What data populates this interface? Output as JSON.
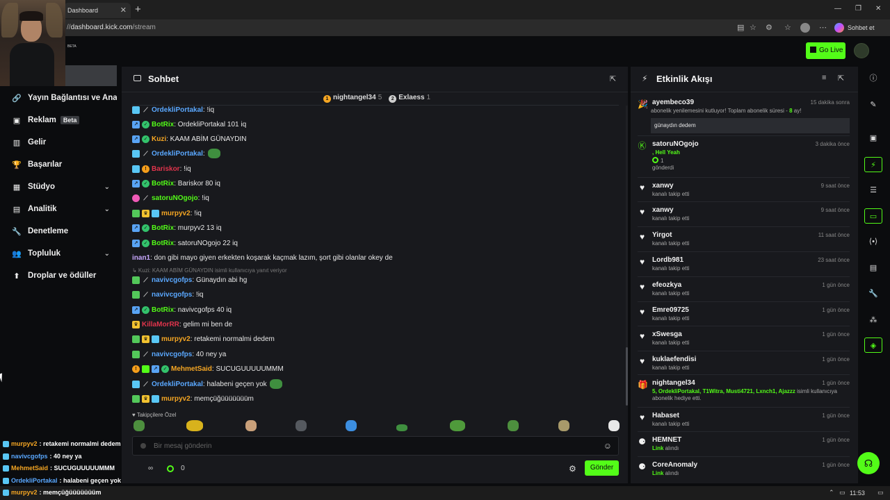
{
  "browser": {
    "tab_title": "Dashboard",
    "tab_close": "✕",
    "new_tab": "+",
    "url_domain": "dashboard.kick.com",
    "url_path": "/stream",
    "url_prefix": "//",
    "sohbet_et": "Sohbet et",
    "win_min": "—",
    "win_max": "❐",
    "win_close": "✕"
  },
  "header": {
    "logo_beta": "BETA",
    "go_live": "Go Live"
  },
  "sidebar": {
    "items": [
      {
        "label": "Yayın Bağlantısı ve Anahtarı",
        "icon": "🔗"
      },
      {
        "label": "Reklam",
        "icon": "▣",
        "badge": "Beta"
      },
      {
        "label": "Gelir",
        "icon": "▥"
      },
      {
        "label": "Başarılar",
        "icon": "🏆"
      },
      {
        "label": "Stüdyo",
        "icon": "▦",
        "chevron": "⌄"
      },
      {
        "label": "Analitik",
        "icon": "▤",
        "chevron": "⌄"
      },
      {
        "label": "Denetleme",
        "icon": "🔧"
      },
      {
        "label": "Topluluk",
        "icon": "👥",
        "chevron": "⌄"
      },
      {
        "label": "Droplar ve ödüller",
        "icon": "⬆"
      }
    ]
  },
  "chat": {
    "title": "Sohbet",
    "top_gifters": [
      {
        "rank": "1",
        "name": "nightangel34",
        "count": "5",
        "color": "#f5a623"
      },
      {
        "rank": "2",
        "name": "Exlaess",
        "count": "1",
        "color": "#cfcfcf"
      }
    ],
    "messages": [
      {
        "user": "OrdekliPortakal",
        "text": ": !iq",
        "color": "#5aa8ff",
        "badges": [
          "sub",
          "sword"
        ]
      },
      {
        "user": "BotRix",
        "text": ": OrdekliPortakal 101 iq",
        "color": "#53fc18",
        "badges": [
          "bot",
          "ver"
        ]
      },
      {
        "user": "Kuzi",
        "text": ": KAAM ABİM GÜNAYDIN",
        "color": "#f5a623",
        "badges": [
          "bot",
          "ver"
        ]
      },
      {
        "user": "OrdekliPortakal",
        "text": ":",
        "color": "#5aa8ff",
        "badges": [
          "sub",
          "sword"
        ],
        "emote": true
      },
      {
        "user": "Bariskor",
        "text": ": !iq",
        "color": "#e0344c",
        "badges": [
          "sub",
          "og"
        ]
      },
      {
        "user": "BotRix",
        "text": ": Bariskor 80 iq",
        "color": "#53fc18",
        "badges": [
          "bot",
          "ver"
        ]
      },
      {
        "user": "satoruNOgojo",
        "text": ": !iq",
        "color": "#53fc18",
        "badges": [
          "pink",
          "sword"
        ]
      },
      {
        "user": "murpyv2",
        "text": ": !iq",
        "color": "#f5a623",
        "badges": [
          "mod",
          "vip",
          "sub"
        ]
      },
      {
        "user": "BotRix",
        "text": ": murpyv2 13 iq",
        "color": "#53fc18",
        "badges": [
          "bot",
          "ver"
        ]
      },
      {
        "user": "BotRix",
        "text": ": satoruNOgojo 22 iq",
        "color": "#53fc18",
        "badges": [
          "bot",
          "ver"
        ]
      },
      {
        "user": "inan1",
        "text": ": don gibi mayo giyen erkekten koşarak kaçmak lazım, şort gibi olanlar okey de",
        "color": "#c8a8ff",
        "badges": []
      },
      {
        "user": "navivcgofps",
        "text": ": Günaydın abi hg",
        "color": "#5aa8ff",
        "badges": [
          "mod",
          "sword"
        ]
      },
      {
        "user": "navivcgofps",
        "text": ": !iq",
        "color": "#5aa8ff",
        "badges": [
          "mod",
          "sword"
        ]
      },
      {
        "user": "BotRix",
        "text": ": navivcgofps 40 iq",
        "color": "#53fc18",
        "badges": [
          "bot",
          "ver"
        ]
      },
      {
        "user": "KillaMorRR",
        "text": ": gelim mi ben de",
        "color": "#e0344c",
        "badges": [
          "vip"
        ]
      },
      {
        "user": "murpyv2",
        "text": ": retakemi normalmi dedem",
        "color": "#f5a623",
        "badges": [
          "mod",
          "vip",
          "sub"
        ]
      },
      {
        "user": "navivcgofps",
        "text": ": 40 ney ya",
        "color": "#5aa8ff",
        "badges": [
          "mod",
          "sword"
        ]
      },
      {
        "user": "MehmetSaid",
        "text": ": SUCUGUUUUUMMM",
        "color": "#f5a623",
        "badges": [
          "og",
          "gift",
          "bot",
          "ver"
        ]
      },
      {
        "user": "OrdekliPortakal",
        "text": ": halabeni geçen yok",
        "color": "#5aa8ff",
        "badges": [
          "sub",
          "sword"
        ],
        "emote": true
      },
      {
        "user": "murpyv2",
        "text": ": memçüğüüüüüüüm",
        "color": "#f5a623",
        "badges": [
          "mod",
          "vip",
          "sub"
        ]
      }
    ],
    "reply_note": "↳ Kuzi: KAAM ABİM GÜNAYDIN isimli kullanıcıya yanıt veriyor",
    "emote_label": "♥ Takipçilere Özel",
    "input_placeholder": "Bir mesaj gönderin",
    "send": "Gönder",
    "points_a": "∞",
    "points_b": "0"
  },
  "activity": {
    "title": "Etkinlik Akışı",
    "items": [
      {
        "user": "ayembeco39",
        "time": "15 dakika sonra",
        "icon": "🎉",
        "desc_pre": "abonelik yenilemesini kutluyor! Toplam abonelik süresi - ",
        "desc_hl": "8",
        "desc_post": " ay!",
        "quote": "günaydın dedem"
      },
      {
        "user": "satoruNOgojo",
        "time": "3 dakika önce",
        "icon": "Ⓚ",
        "hl1": ", Hell Yeah",
        "amount": "1",
        "desc2": "gönderdi"
      },
      {
        "user": "xanwy",
        "time": "9 saat önce",
        "icon": "♥",
        "desc": "kanalı takip etti"
      },
      {
        "user": "xanwy",
        "time": "9 saat önce",
        "icon": "♥",
        "desc": "kanalı takip etti"
      },
      {
        "user": "Yirgot",
        "time": "11 saat önce",
        "icon": "♥",
        "desc": "kanalı takip etti"
      },
      {
        "user": "Lordb981",
        "time": "23 saat önce",
        "icon": "♥",
        "desc": "kanalı takip etti"
      },
      {
        "user": "efeozkya",
        "time": "1 gün önce",
        "icon": "♥",
        "desc": "kanalı takip etti"
      },
      {
        "user": "Emre09725",
        "time": "1 gün önce",
        "icon": "♥",
        "desc": "kanalı takip etti"
      },
      {
        "user": "xSwesga",
        "time": "1 gün önce",
        "icon": "♥",
        "desc": "kanalı takip etti"
      },
      {
        "user": "kuklaefendisi",
        "time": "1 gün önce",
        "icon": "♥",
        "desc": "kanalı takip etti"
      },
      {
        "user": "nightangel34",
        "time": "1 gün önce",
        "icon": "🎁",
        "hl_line": "5, OrdekliPortakal, T1Witra, Musti4721, Lxnch1, Ajazzz",
        "hl_post": " isimli kullanıcıya",
        "desc2": "abonelik hediye etti."
      },
      {
        "user": "Habaset",
        "time": "1 gün önce",
        "icon": "♥",
        "desc": "kanalı takip etti"
      },
      {
        "user": "HEMNET",
        "time": "1 gün önce",
        "icon": "⚈",
        "link": "Link",
        "desc_post": " alındı"
      },
      {
        "user": "CoreAnomaly",
        "time": "1 gün önce",
        "icon": "⚈",
        "link": "Link",
        "desc_post": " alındı"
      }
    ]
  },
  "overlay": {
    "lines": [
      {
        "user": "murpyv2",
        "text": ": retakemi normalmi dedem",
        "color": "#f5a623"
      },
      {
        "user": "navivcgofps",
        "text": ": 40 ney ya",
        "color": "#5aa8ff"
      },
      {
        "user": "MehmetSaid",
        "text": ": SUCUGUUUUUMMM",
        "color": "#f5a623"
      },
      {
        "user": "OrdekliPortakal",
        "text": ": halabeni geçen yok",
        "color": "#5aa8ff"
      },
      {
        "user": "murpyv2",
        "text": ": memçüğüüüüüüüm",
        "color": "#f5a623"
      }
    ]
  },
  "taskbar": {
    "clock": "11:53"
  }
}
